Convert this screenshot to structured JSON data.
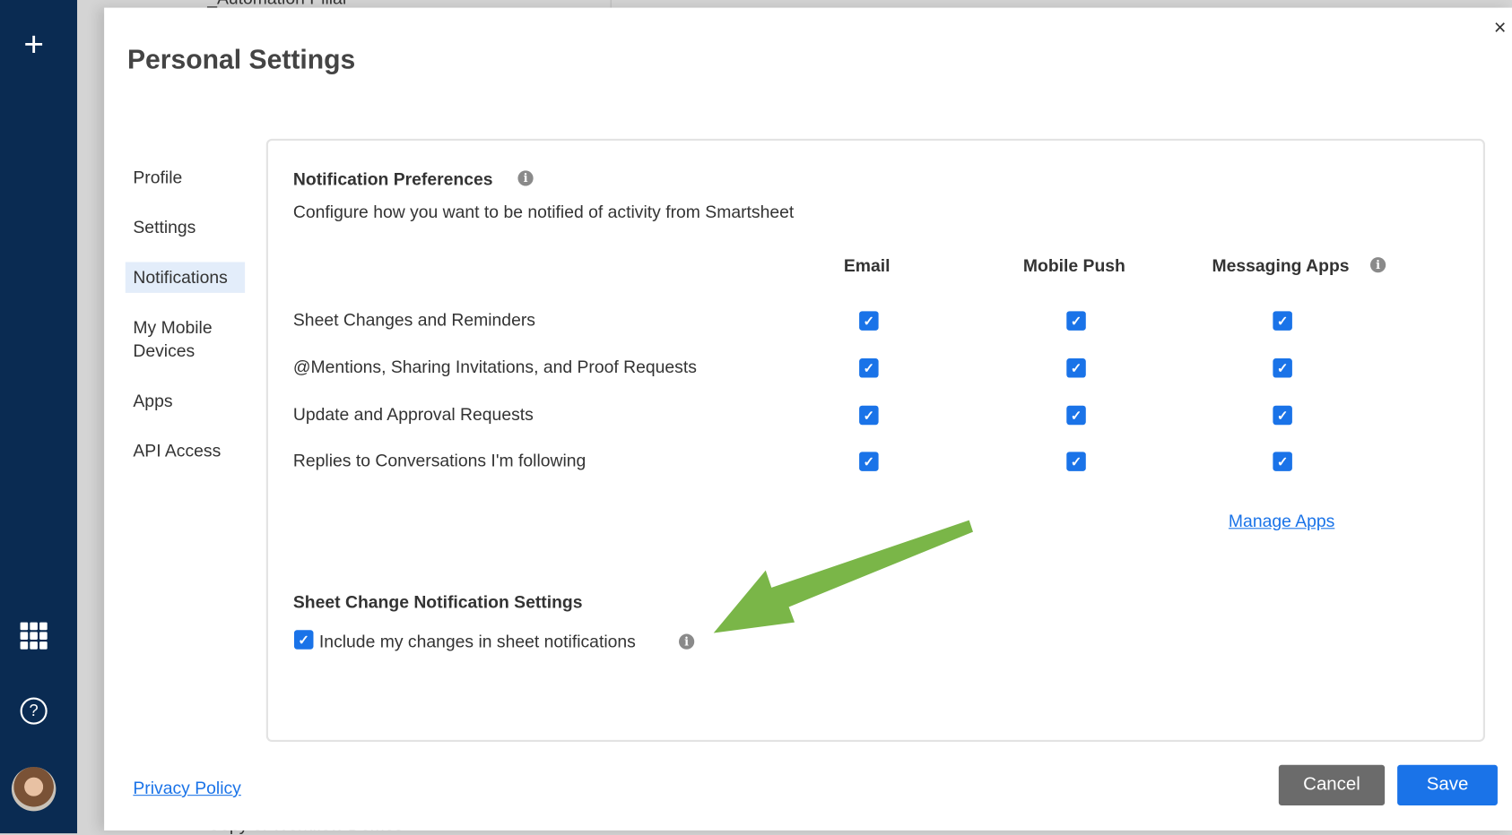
{
  "background": {
    "top_item": "_Automation Pillar",
    "bottom_item": "Copy of Workflow Demos"
  },
  "nav": {
    "icons": [
      "plus-icon",
      "apps-grid-icon",
      "help-icon",
      "avatar"
    ],
    "help_glyph": "?",
    "plus_glyph": "+"
  },
  "dialog": {
    "title": "Personal Settings",
    "close_glyph": "×",
    "menu": [
      {
        "label": "Profile"
      },
      {
        "label": "Settings"
      },
      {
        "label": "Notifications",
        "active": true
      },
      {
        "label": "My Mobile Devices"
      },
      {
        "label": "Apps"
      },
      {
        "label": "API Access"
      }
    ],
    "notifications": {
      "heading": "Notification Preferences",
      "description": "Configure how you want to be notified of activity from Smartsheet",
      "columns": [
        "Email",
        "Mobile Push",
        "Messaging Apps"
      ],
      "rows": [
        {
          "label": "Sheet Changes and Reminders",
          "values": [
            true,
            true,
            true
          ]
        },
        {
          "label": "@Mentions, Sharing Invitations, and Proof Requests",
          "values": [
            true,
            true,
            true
          ]
        },
        {
          "label": "Update and Approval Requests",
          "values": [
            true,
            true,
            true
          ]
        },
        {
          "label": "Replies to Conversations I'm following",
          "values": [
            true,
            true,
            true
          ]
        }
      ],
      "manage_apps": "Manage Apps"
    },
    "sheet_change": {
      "heading": "Sheet Change Notification Settings",
      "include_my_changes_label": "Include my changes in sheet notifications",
      "include_my_changes": true
    },
    "privacy_policy": "Privacy Policy",
    "cancel": "Cancel",
    "save": "Save"
  },
  "colors": {
    "nav": "#0a2b52",
    "accent": "#1a73e8",
    "arrow": "#7ab648",
    "cancel": "#6b6b6b"
  }
}
